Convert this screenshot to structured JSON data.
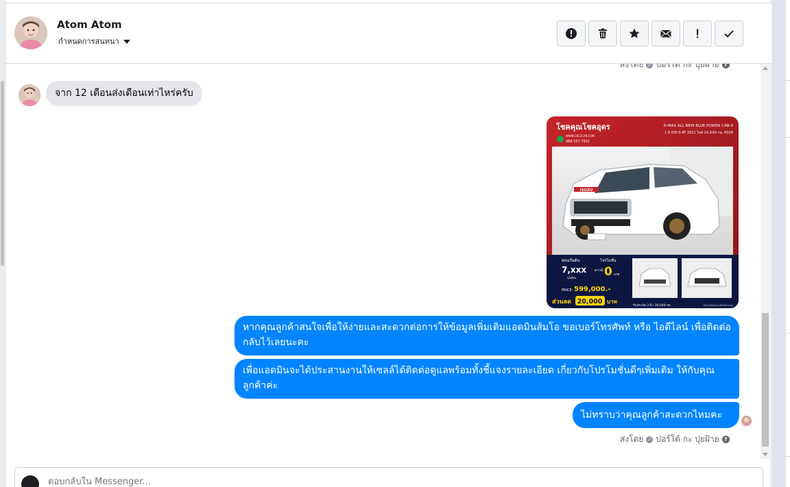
{
  "conversation": {
    "contact_name": "Atom Atom",
    "assign_label": "กำหนดการสนทนา"
  },
  "toolbar": {
    "items": [
      {
        "icon": "alert-circle-icon",
        "glyph": "!"
      },
      {
        "icon": "trash-icon"
      },
      {
        "icon": "star-icon"
      },
      {
        "icon": "envelope-icon"
      },
      {
        "icon": "exclamation-icon",
        "glyph": "!"
      },
      {
        "icon": "check-icon"
      }
    ]
  },
  "messages": {
    "sent_by_top": {
      "prefix": "ส่งโดย",
      "name": "ปอร์โต้ กะ ปุยฝ้าย"
    },
    "incoming_1": "จาก 12 เดือนส่งเดือนเท่าไหร่ครับ",
    "ad_card": {
      "brand": "โชคคุณโชคอุดร",
      "model": "D-MAX ALL NEW BLUE POWER CAB-4",
      "spec": "1.9 DDI S AT 2021 ไมล์ 1X,XXX กม. K029",
      "website": "WWW.CKC2CAR.COM",
      "phone": "088 557 7932",
      "badge_brand": "ISUZU",
      "monthly_label": "ผ่อนเริ่มต้น",
      "monthly_value": "7,xxx",
      "monthly_unit": "บ/เดือน",
      "promo_label": "โปรโมชั่น",
      "promo_prefix": "ดาวน์",
      "promo_value": "0",
      "promo_unit": "บาท",
      "price_label": "PRICE:",
      "price_value": "599,000.-",
      "discount_label": "ส่วนลด",
      "discount_value": "20,000",
      "discount_unit": "บาท",
      "warranty": "รับประกัน 3 ปี / 30,000 กม.",
      "footnote": "*เงื่อนไขเป็นไปตามที่บริษัทกำหนด"
    },
    "outgoing_1": "หากคุณลูกค้าสนใจเพื่อให้ง่ายและสะดวกต่อการให้ข้อมูลเพิ่มเติมแอดมินส้มโอ ขอเบอร์โทรศัพท์ หรือ ไอดีไลน์ เพื่อติดต่อกลับไว้เลยนะคะ",
    "outgoing_2": "เพื่อแอดมินจะได้ประสานงานให้เซลล์ได้ติดต่อดูแลพร้อมทั้งชี้แจงรายละเอียด เกี่ยวกับโปรโมชั่นดีๆเพิ่มเติม ให้กับคุณลูกค้าค่ะ",
    "outgoing_3": "ไม่ทราบว่าคุณลูกค้าสะดวกไหมคะ",
    "sent_by_bottom": {
      "prefix": "ส่งโดย",
      "name": "ปอร์โต้ กะ ปุยฝ้าย"
    }
  },
  "composer": {
    "placeholder": "ตอบกลับใน Messenger..."
  },
  "colors": {
    "outgoing_bubble": "#0084ff",
    "incoming_bubble": "#e4e6eb",
    "ad_red": "#b01e23",
    "ad_navy": "#0d1640",
    "ad_yellow": "#ffd400"
  }
}
